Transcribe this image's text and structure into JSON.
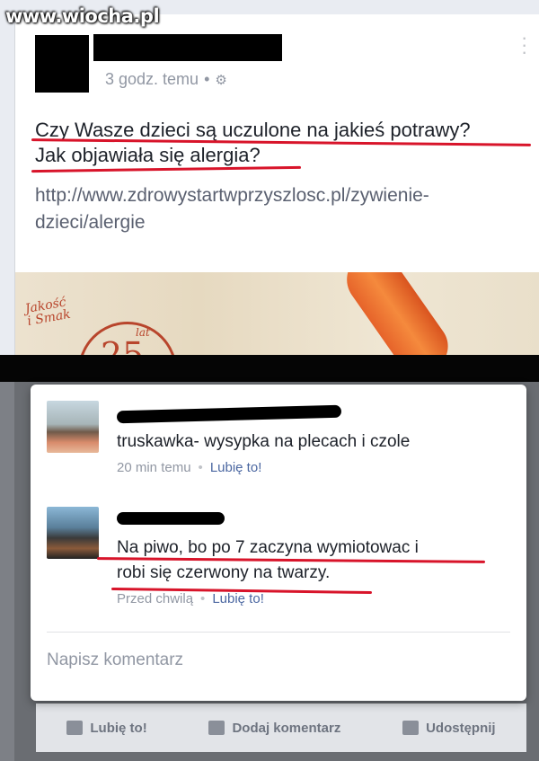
{
  "watermark": "www.wiocha.pl",
  "post": {
    "time": "3 godz. temu",
    "separator": "•",
    "gear_icon": "gear-icon",
    "text_line1": "Czy Wasze dzieci są uczulone na jakieś potrawy?",
    "text_line2": "Jak objawiała się alergia?",
    "link_line1": "http://www.zdrowystartwprzyszlosc.pl/zywienie-",
    "link_line2": "dzieci/alergie",
    "ad_logo_line1": "Jakość",
    "ad_logo_line2": "i Smak",
    "ad_years": "25",
    "ad_lat": "lat"
  },
  "actions": {
    "like": "Lubię to!",
    "comment": "Dodaj komentarz",
    "share": "Udostępnij"
  },
  "comments": [
    {
      "text": "truskawka- wysypka na plecach i czole",
      "time": "20 min temu",
      "like": "Lubię to!"
    },
    {
      "text_line1": "Na piwo, bo po 7 zaczyna wymiotowac i",
      "text_line2": "robi się czerwony na twarzy.",
      "time": "Przed chwilą",
      "like": "Lubię to!"
    }
  ],
  "comment_input": {
    "placeholder": "Napisz komentarz"
  },
  "colors": {
    "annotation_red": "#d8142a",
    "link_blue": "#4b67a1"
  }
}
